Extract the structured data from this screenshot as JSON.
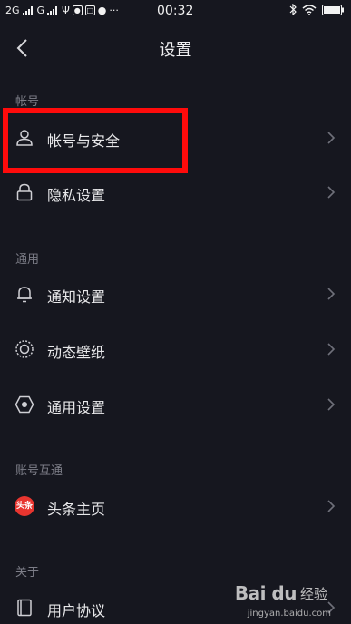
{
  "status_bar": {
    "network1": "2G",
    "network2": "G",
    "time": "00:32"
  },
  "header": {
    "title": "设置"
  },
  "sections": {
    "account": "帐号",
    "general": "通用",
    "interconnect": "账号互通",
    "about": "关于"
  },
  "items": {
    "account_security": "帐号与安全",
    "privacy": "隐私设置",
    "notification": "通知设置",
    "live_wallpaper": "动态壁纸",
    "general_settings": "通用设置",
    "toutiao_home": "头条主页",
    "user_agreement": "用户协议"
  },
  "toutiao_badge": "头条",
  "watermark": {
    "logo": "Bai du",
    "text": "经验",
    "url": "jingyan.baidu.com"
  },
  "colors": {
    "background": "#16171f",
    "highlight": "#ff0b0b",
    "toutiao_red": "#e8352f"
  }
}
